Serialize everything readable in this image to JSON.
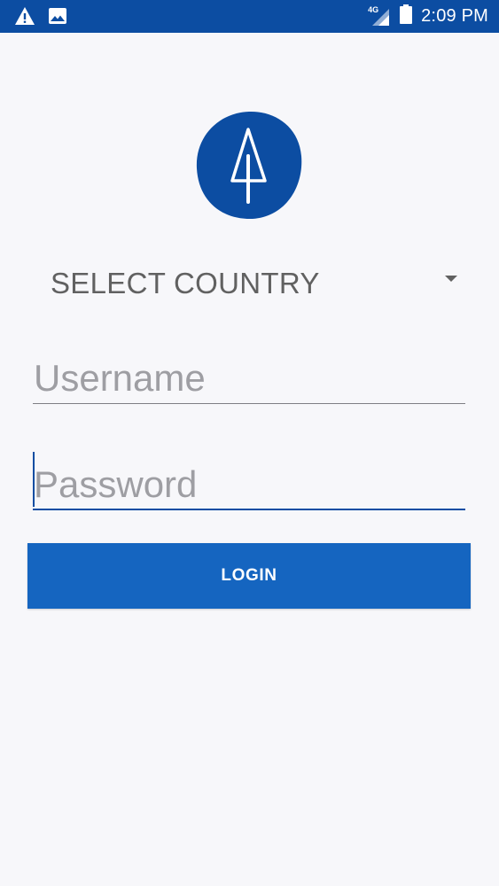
{
  "status_bar": {
    "time": "2:09 PM",
    "network_type": "4G",
    "icons": [
      "warning-icon",
      "image-icon",
      "signal-icon",
      "battery-icon"
    ],
    "background_color": "#0C4DA2"
  },
  "logo": {
    "icon": "tree-logo-icon",
    "color": "#0C4DA2"
  },
  "country_select": {
    "label": "SELECT COUNTRY"
  },
  "username": {
    "placeholder": "Username",
    "value": ""
  },
  "password": {
    "placeholder": "Password",
    "value": ""
  },
  "login_button": {
    "label": "LOGIN",
    "color": "#1565C0"
  }
}
